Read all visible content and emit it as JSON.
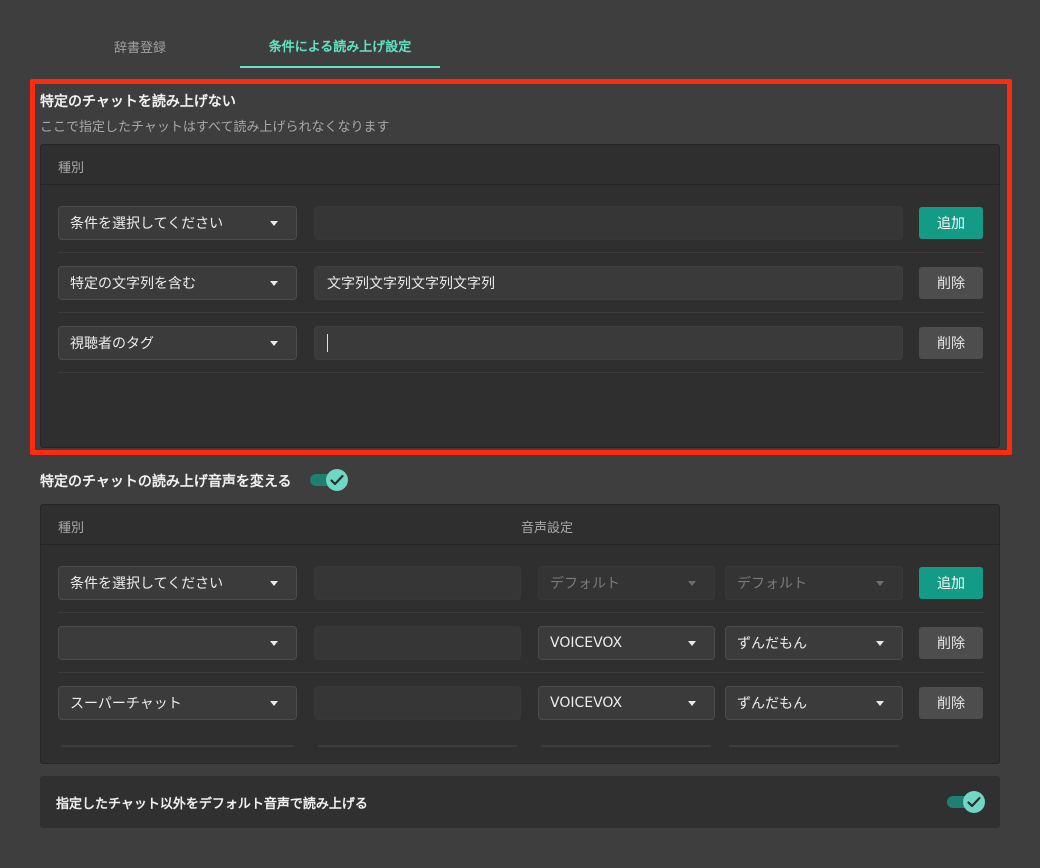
{
  "tabs": [
    {
      "label": "辞書登録",
      "active": false
    },
    {
      "label": "条件による読み上げ設定",
      "active": true
    }
  ],
  "section1": {
    "title": "特定のチャットを読み上げない",
    "description": "ここで指定したチャットはすべて読み上げられなくなります",
    "header": "種別",
    "rows": [
      {
        "condition": "条件を選択してください",
        "value": "",
        "button": "追加"
      },
      {
        "condition": "特定の文字列を含む",
        "value": "文字列文字列文字列文字列",
        "button": "削除"
      },
      {
        "condition": "視聴者のタグ",
        "value": "",
        "button": "削除"
      }
    ]
  },
  "section2": {
    "title": "特定のチャットの読み上げ音声を変える",
    "toggle_on": true,
    "header_type": "種別",
    "header_voice": "音声設定",
    "rows": [
      {
        "condition": "条件を選択してください",
        "value": "",
        "engine": "デフォルト",
        "voice": "デフォルト",
        "button": "追加"
      },
      {
        "condition": "",
        "value": "",
        "engine": "VOICEVOX",
        "voice": "ずんだもん",
        "button": "削除"
      },
      {
        "condition": "スーパーチャット",
        "value": "",
        "engine": "VOICEVOX",
        "voice": "ずんだもん",
        "button": "削除"
      }
    ]
  },
  "section3": {
    "label": "指定したチャット以外をデフォルト音声で読み上げる",
    "toggle_on": true
  },
  "colors": {
    "accent": "#5fe3c3",
    "add_button": "#139b87",
    "highlight": "#ff2a10"
  }
}
